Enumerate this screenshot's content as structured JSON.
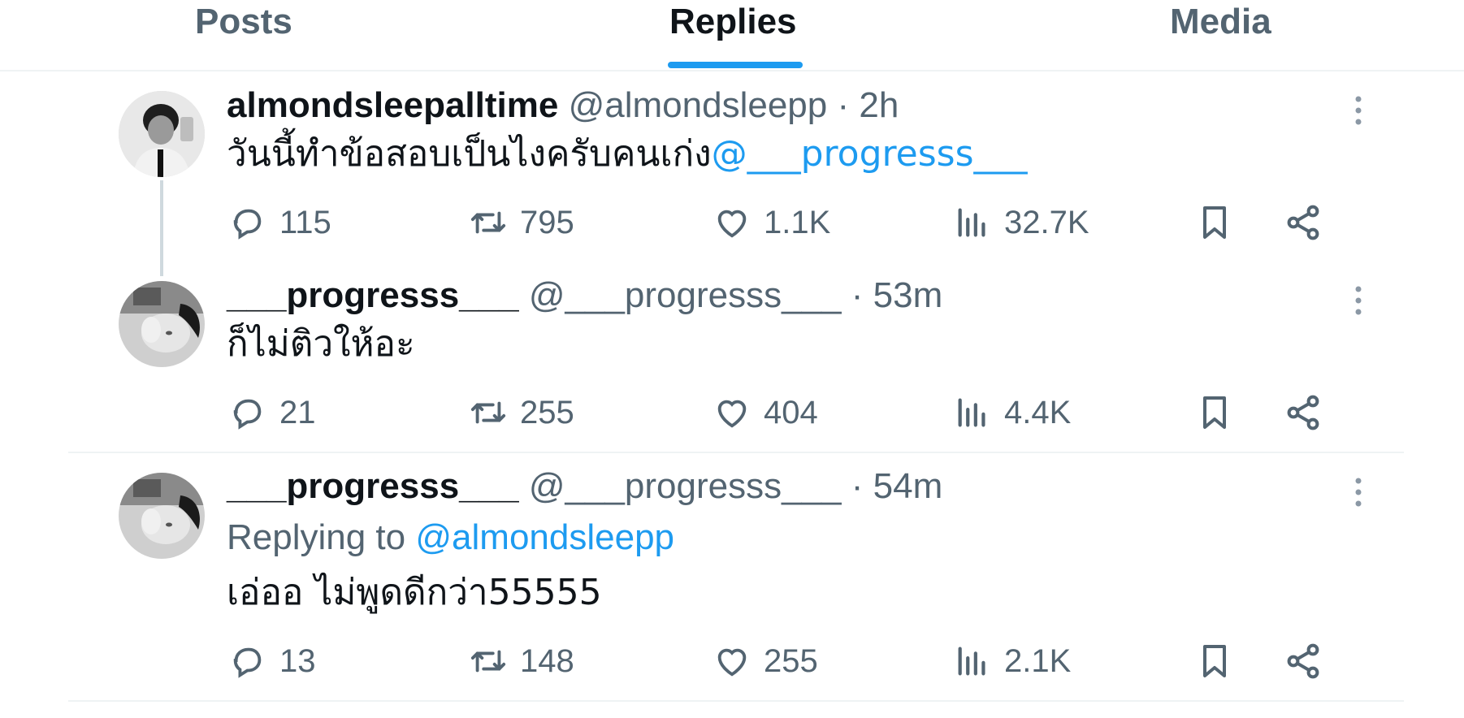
{
  "tabs": {
    "posts": "Posts",
    "replies": "Replies",
    "media": "Media"
  },
  "posts": [
    {
      "name": "almondsleepalltime",
      "handle": "@almondsleepp",
      "time": "· 2h",
      "text": "วันนี้ทำข้อสอบเป็นไงครับคนเก่ง",
      "mention": "@___progresss___",
      "stats": {
        "replies": "115",
        "reposts": "795",
        "likes": "1.1K",
        "views": "32.7K"
      }
    },
    {
      "name": "___progresss___",
      "handle": "@___progresss___",
      "time": "· 53m",
      "text": "ก็ไม่ติวให้อะ",
      "stats": {
        "replies": "21",
        "reposts": "255",
        "likes": "404",
        "views": "4.4K"
      }
    },
    {
      "name": "___progresss___",
      "handle": "@___progresss___",
      "time": "· 54m",
      "replying_prefix": "Replying to",
      "replying_handle": "@almondsleepp",
      "text": "เอ่ออ ไม่พูดดีกว่า55555",
      "stats": {
        "replies": "13",
        "reposts": "148",
        "likes": "255",
        "views": "2.1K"
      }
    }
  ],
  "colors": {
    "accent": "#1d9bf0",
    "muted": "#536471",
    "text": "#0f1419",
    "divider": "#eff3f4"
  }
}
